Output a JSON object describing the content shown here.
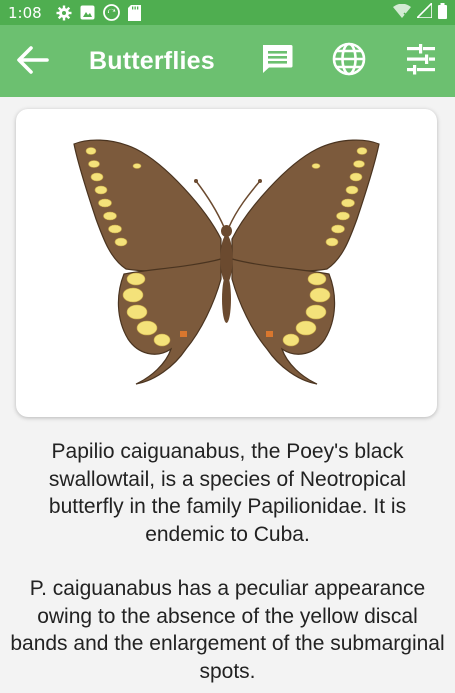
{
  "status_bar": {
    "time": "1:08",
    "icons": [
      "gear-icon",
      "photo-icon",
      "sync-icon",
      "sd-card-icon",
      "wifi-icon",
      "signal-icon",
      "battery-icon"
    ]
  },
  "app_bar": {
    "title": "Butterflies",
    "actions": [
      "comment-icon",
      "globe-icon",
      "tune-icon"
    ],
    "background": "#6cc070"
  },
  "description": {
    "paragraph1": "Papilio caiguanabus, the Poey's black swallowtail, is a species of Neotropical butterfly in the family Papilionidae. It is endemic to Cuba.",
    "paragraph2": "P. caiguanabus has a peculiar appearance owing to the absence of the yellow discal bands and the enlargement of the submarginal spots."
  },
  "colors": {
    "status_bar": "#4fae50",
    "wing_brown": "#7c5a3c",
    "spot_yellow": "#f4e27a"
  }
}
